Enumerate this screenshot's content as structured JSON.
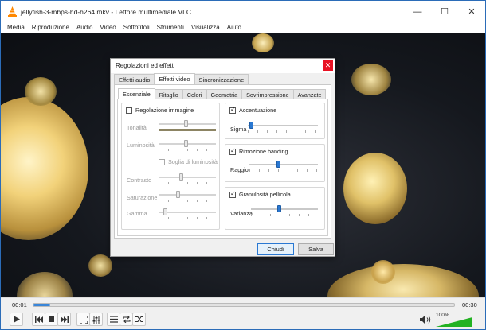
{
  "window": {
    "title": "jellyfish-3-mbps-hd-h264.mkv - Lettore multimediale VLC",
    "controls": [
      "—",
      "☐",
      "✕"
    ]
  },
  "menu": [
    "Media",
    "Riproduzione",
    "Audio",
    "Video",
    "Sottotitoli",
    "Strumenti",
    "Visualizza",
    "Aiuto"
  ],
  "player": {
    "time_elapsed": "00:01",
    "time_total": "00:30",
    "progress_fraction": 0.04,
    "volume_label": "100%",
    "volume_fraction": 1.0,
    "accent": "#3a86d8",
    "volume_color": "#22b222"
  },
  "dialog": {
    "title": "Regolazioni ed effetti",
    "close": "✕",
    "tabs": [
      "Effetti audio",
      "Effetti video",
      "Sincronizzazione"
    ],
    "active_tab": 1,
    "subtabs": [
      "Essenziale",
      "Ritaglio",
      "Colori",
      "Geometria",
      "Sovrimpressione",
      "Avanzate"
    ],
    "active_subtab": 0,
    "left": {
      "image_adjust": {
        "label": "Regolazione immagine",
        "checked": false
      },
      "hue": "Tonalità",
      "brightness": "Luminosità",
      "brightness_threshold": "Soglia di luminosità",
      "contrast": "Contrasto",
      "saturation": "Saturazione",
      "gamma": "Gamma"
    },
    "right": {
      "sharpen": {
        "label": "Accentuazione",
        "checked": true,
        "param": "Sigma",
        "value_fraction": 0.02
      },
      "banding": {
        "label": "Rimozione banding",
        "checked": true,
        "param": "Raggio",
        "value_fraction": 0.42
      },
      "grain": {
        "label": "Granulosità pellicola",
        "checked": true,
        "param": "Varianza",
        "value_fraction": 0.42
      }
    },
    "buttons": {
      "close": "Chiudi",
      "save": "Salva"
    }
  }
}
